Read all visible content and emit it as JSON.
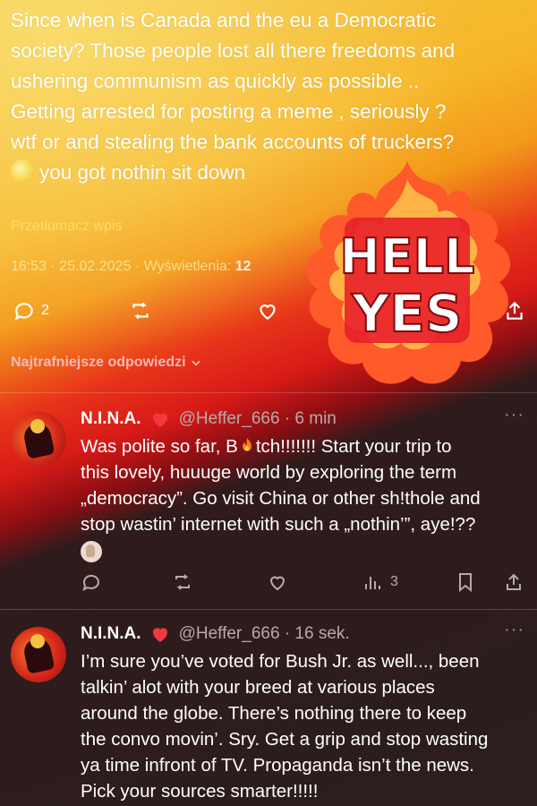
{
  "post": {
    "lines": [
      "Since when is Canada and the eu a Democratic",
      "society?  Those people lost all there freedoms and",
      "ushering communism as quickly as possible ..",
      "Getting arrested for posting a meme , seriously ?",
      "wtf or and stealing the bank accounts of truckers?"
    ],
    "last_line": "you got nothin sit down",
    "translate_label": "Przetłumacz wpis",
    "time": "16:53",
    "date": "25.02.2025",
    "views_label": "Wyświetlenia:",
    "views_count": "12",
    "reply_count": "2"
  },
  "sticker_text": {
    "line1": "HELL",
    "line2": "YES"
  },
  "sort_label": "Najtrafniejsze odpowiedzi",
  "replies": [
    {
      "name": "N.I.N.A.",
      "handle": "@Heffer_666",
      "time": "6 min",
      "body_part1": "Was polite so far, B",
      "body_part2": "tch!!!!!!! Start your trip to",
      "lines": [
        "this lovely, huuuge world by exploring the term",
        "„democracy”. Go visit China or other sh!thole and",
        "stop wastin’ internet with such a „nothin’”, aye!??"
      ],
      "views": "3"
    },
    {
      "name": "N.I.N.A.",
      "handle": "@Heffer_666",
      "time": "16 sek.",
      "lines": [
        "I’m sure you’ve voted for Bush Jr. as well..., been",
        "talkin’ alot with your breed at various places",
        "around the globe. There’s nothing there to keep",
        "the convo movin’. Sry. Get a grip and stop wasting",
        "ya time infront of TV. Propaganda isn’t the news.",
        "Pick your sources smarter!!!!!"
      ]
    }
  ],
  "colors": {
    "accent_red": "#e0241a",
    "heart": "#f0383e",
    "text_muted": "#b8aaaa"
  }
}
